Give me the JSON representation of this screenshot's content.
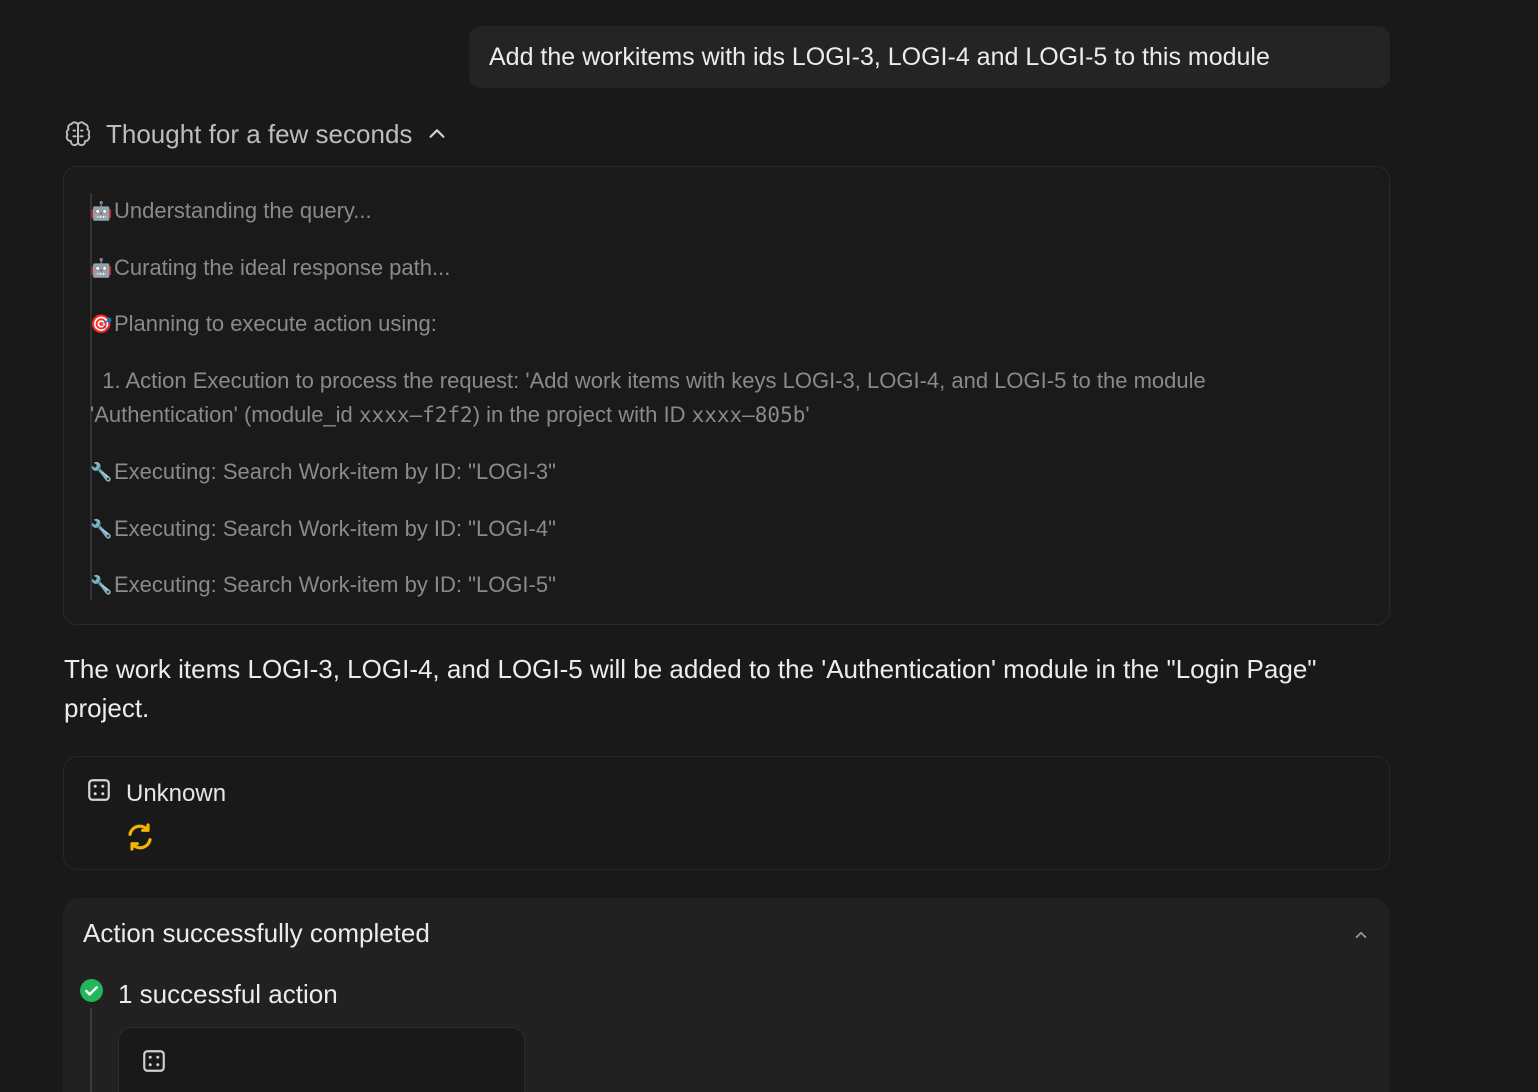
{
  "user_message": "Add the workitems with ids LOGI-3, LOGI-4 and LOGI-5 to this module",
  "thought": {
    "header": "Thought for a few seconds",
    "steps": [
      {
        "emoji": "🤖",
        "text": "Understanding the query..."
      },
      {
        "emoji": "🤖",
        "text": "Curating the ideal response path..."
      },
      {
        "emoji": "🎯",
        "text": "Planning to execute action using:"
      },
      {
        "text_a": "  1. Action Execution to process the request: 'Add work items with keys LOGI-3, LOGI-4, and LOGI-5 to the module 'Authentication' (module_id ",
        "mono_1": "xxxx–f2f2",
        "text_b": ") in the project with ID ",
        "mono_2": "xxxx–805b",
        "text_c": "'"
      },
      {
        "emoji": "🔧",
        "text": "Executing: Search Work-item by ID: \"LOGI-3\""
      },
      {
        "emoji": "🔧",
        "text": "Executing: Search Work-item by ID: \"LOGI-4\""
      },
      {
        "emoji": "🔧",
        "text": "Executing: Search Work-item by ID: \"LOGI-5\""
      }
    ]
  },
  "response": "The work items LOGI-3, LOGI-4, and LOGI-5 will be added to the 'Authentication' module in the \"Login Page\" project.",
  "unknown_card": {
    "title": "Unknown",
    "icon": "module-icon",
    "status_icon": "refresh-icon",
    "status_color": "#f5b400"
  },
  "action_card": {
    "title": "Action successfully completed",
    "success_label": "1 successful action",
    "success_color": "#22b55a"
  }
}
